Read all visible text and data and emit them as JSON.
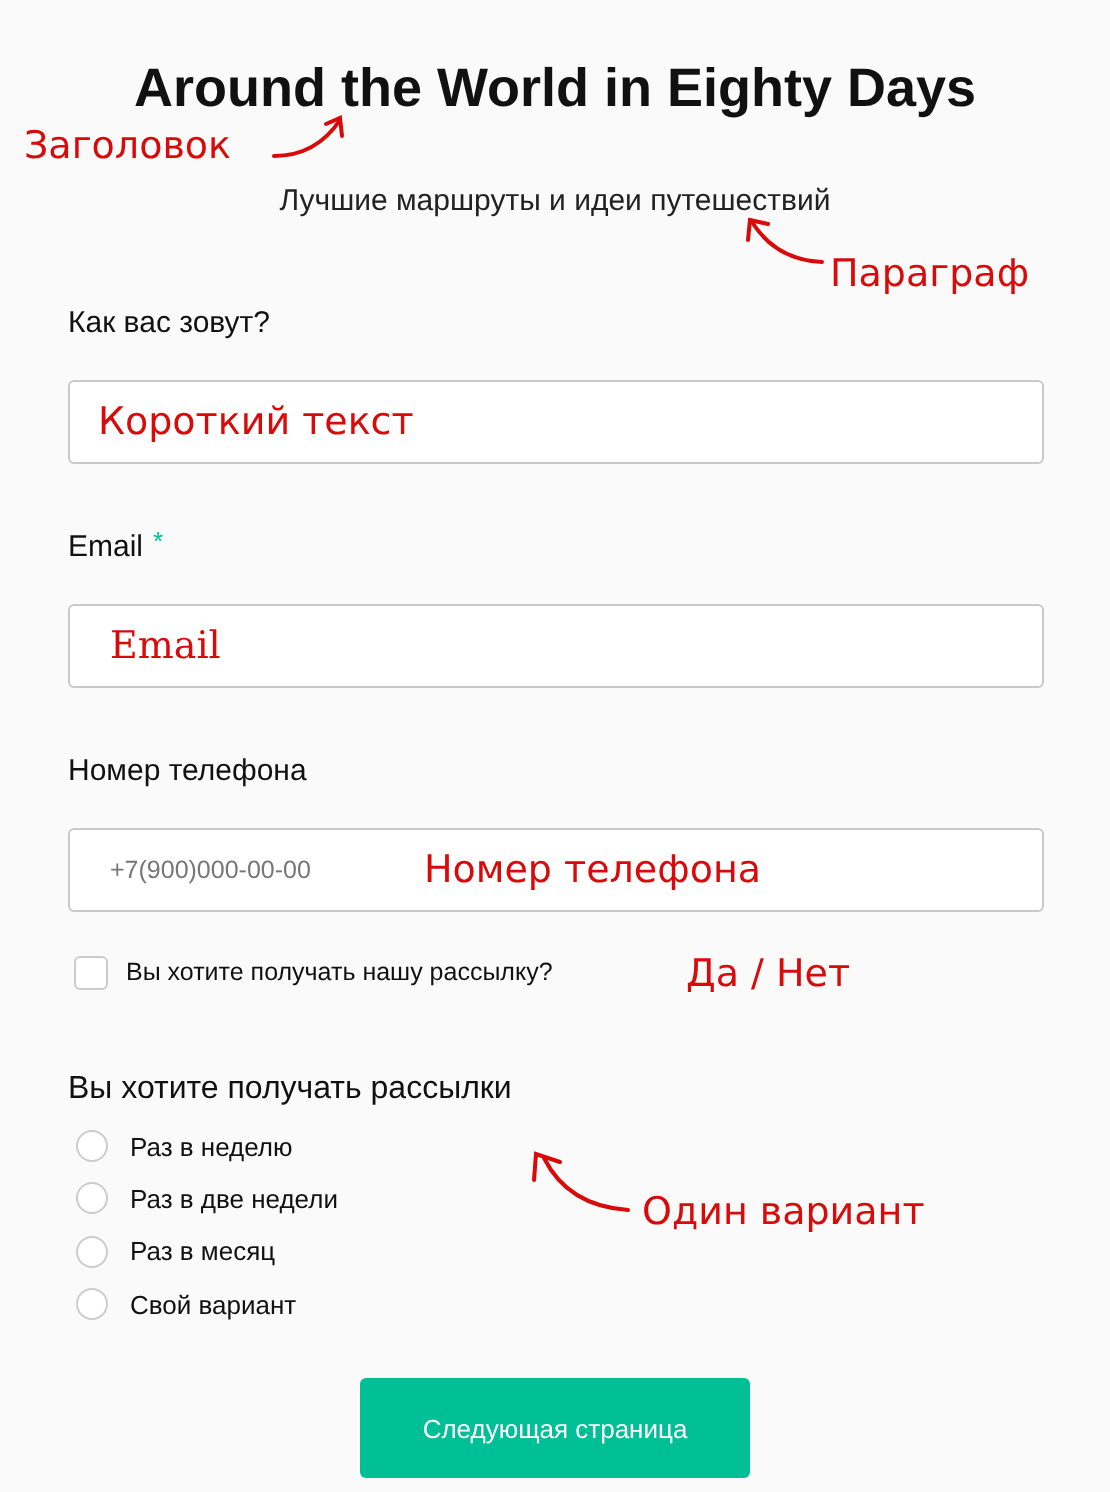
{
  "title": {
    "text": "Around the World in Eighty Days",
    "annotation": "Заголовок"
  },
  "subtitle": {
    "text": "Лучшие маршруты и идеи путешествий",
    "annotation": "Параграф"
  },
  "fields": [
    {
      "label": "Как вас зовут?",
      "annotation": "Короткий текст"
    },
    {
      "label": "Email",
      "required_mark": "*",
      "annotation": "Email"
    },
    {
      "label": "Номер телефона",
      "placeholder": "+7(900)000-00-00",
      "annotation": "Номер телефона"
    }
  ],
  "checkbox": {
    "label": "Вы хотите получать нашу рассылку?",
    "checked": false,
    "annotation": "Да / Нет"
  },
  "radio_group": {
    "title": "Вы хотите получать рассылки",
    "annotation": "Один вариант",
    "options": [
      {
        "label": "Раз в неделю",
        "selected": false
      },
      {
        "label": "Раз в две недели",
        "selected": false
      },
      {
        "label": "Раз в месяц",
        "selected": false
      },
      {
        "label": "Свой вариант",
        "selected": false
      }
    ]
  },
  "button": "Следующая страница"
}
